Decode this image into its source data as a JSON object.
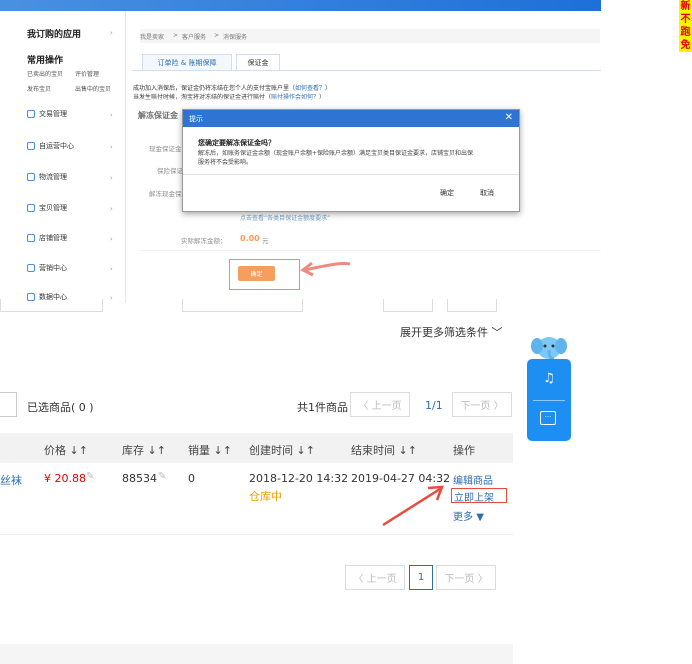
{
  "sidebar": {
    "my_apps": "我订购的应用",
    "common_ops": "常用操作",
    "quick_links": [
      "已卖出的宝贝",
      "评价管理",
      "发布宝贝",
      "出售中的宝贝"
    ],
    "items": [
      {
        "label": "交易管理",
        "icon": "trade-icon"
      },
      {
        "label": "自运营中心",
        "icon": "chat-icon"
      },
      {
        "label": "物流管理",
        "icon": "truck-icon"
      },
      {
        "label": "宝贝管理",
        "icon": "bag-icon"
      },
      {
        "label": "店铺管理",
        "icon": "store-icon"
      },
      {
        "label": "营销中心",
        "icon": "marketing-icon"
      },
      {
        "label": "数据中心",
        "icon": "data-icon"
      }
    ]
  },
  "breadcrumb": [
    "我是卖家",
    "客户服务",
    "消保服务"
  ],
  "tabs": [
    "订单险 & 账期保障",
    "保证金"
  ],
  "notice": {
    "line1": "成功加入消保后，保证金仍将冻结在您个人的支付宝账户里（",
    "link1": "如何查看？",
    "line2": "当发生赔付时候，淘宝将对冻结的保证金进行赔付（",
    "link2": "赔付操作会如何？"
  },
  "section_title": "解冻保证金",
  "form": {
    "label_current": "现金保证金",
    "label_insurance": "保险保证",
    "label_unfreeze": "解冻现金保",
    "link_requirements": "点击查看“各类目保证金额度要求”",
    "actual_label": "实际解冻金额：",
    "actual_amount": "0.00",
    "actual_unit": "元",
    "confirm_label": "确定"
  },
  "dialog": {
    "title": "提示",
    "question": "您确定要解冻保证金吗？",
    "desc_line1": "解冻后，如账务保证金余额（现金账户余额+保险账户余额）满足宝贝类目保证金要求，店铺宝贝和出保",
    "desc_line2": "服务将不会受影响。",
    "ok": "确定",
    "cancel": "取消"
  },
  "list": {
    "more_filters": "展开更多筛选条件",
    "selected": "已选商品( 0 )",
    "total": "共1件商品",
    "prev": "上一页",
    "page": "1/1",
    "next": "下一页",
    "headers": [
      "价格",
      "库存",
      "销量",
      "创建时间",
      "结束时间",
      "操作"
    ],
    "row": {
      "title_tail": "丝袜",
      "price": "¥ 20.88",
      "stock": "88534",
      "sales": "0",
      "created": "2018-12-20 14:32",
      "status": "仓库中",
      "ended": "2019-04-27 04:32",
      "edit": "编辑商品",
      "list_now": "立即上架",
      "more": "更多"
    },
    "bottom_prev": "上一页",
    "bottom_page": "1",
    "bottom_next": "下一页"
  },
  "side_ad": [
    "新",
    "不",
    "跑",
    "免"
  ],
  "colors": {
    "accent": "#2d74d3",
    "orange": "#f26b0b",
    "red": "#e84c3d",
    "float": "#1e8ff2"
  }
}
